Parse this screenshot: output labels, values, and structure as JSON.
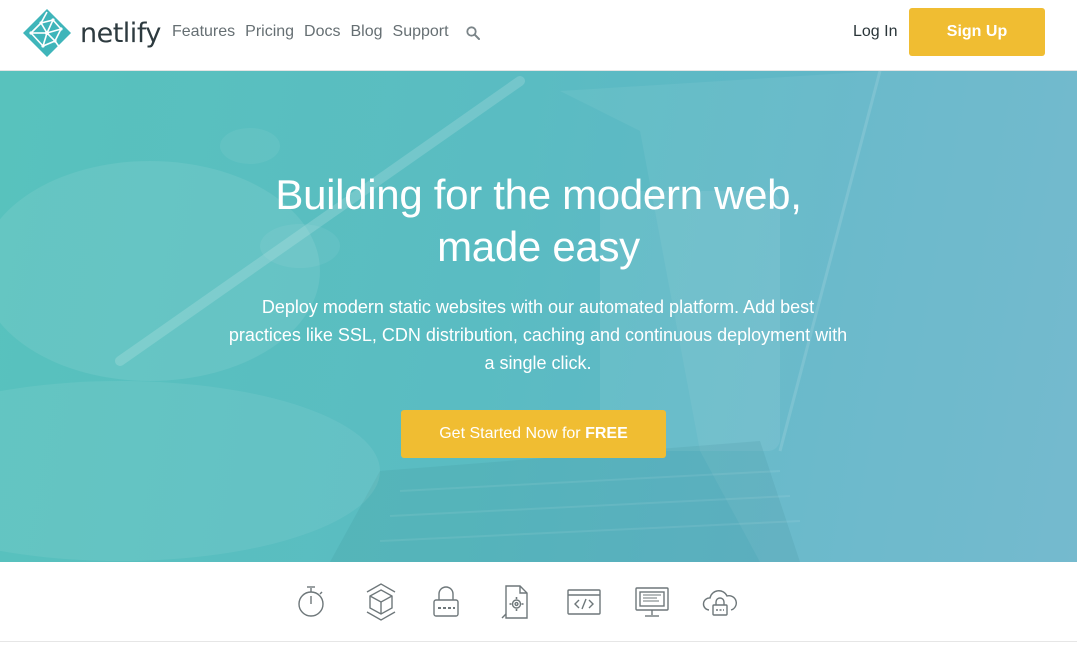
{
  "brand": {
    "name": "netlify",
    "accent": "#f0bd32",
    "logo_color": "#3fb5ba"
  },
  "nav": {
    "items": [
      {
        "label": "Features"
      },
      {
        "label": "Pricing"
      },
      {
        "label": "Docs"
      },
      {
        "label": "Blog"
      },
      {
        "label": "Support"
      }
    ],
    "search_icon": "search-icon",
    "login_label": "Log In",
    "signup_label": "Sign Up"
  },
  "hero": {
    "title_line1": "Building for the modern web,",
    "title_line2": "made easy",
    "subtitle": "Deploy modern static websites with our automated platform. Add best practices like SSL, CDN distribution, caching and continuous deployment with a single click.",
    "cta_prefix": "Get Started Now for ",
    "cta_strong": "FREE",
    "background": "#58c2bd"
  },
  "features": {
    "icons": [
      "stopwatch-icon",
      "cube-icon",
      "lock-icon",
      "file-gear-icon",
      "code-window-icon",
      "monitor-icon",
      "cloud-lock-icon"
    ]
  }
}
